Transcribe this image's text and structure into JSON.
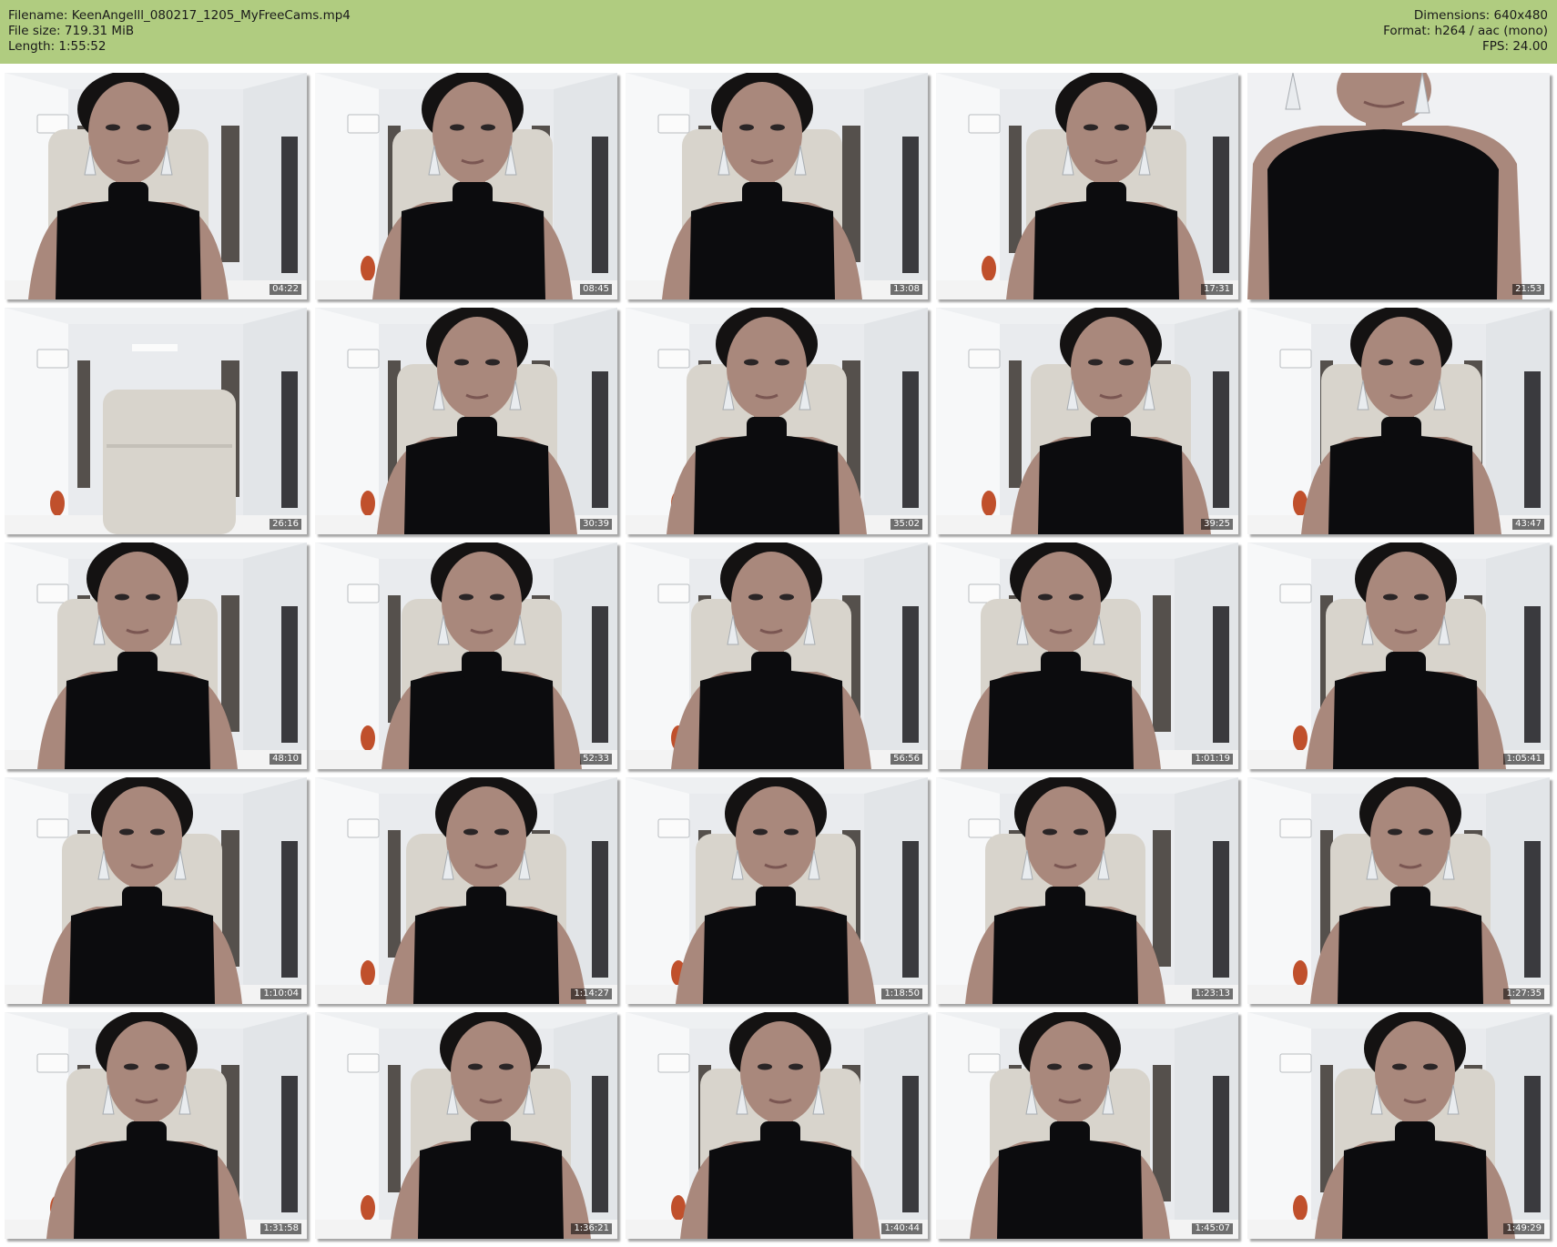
{
  "header": {
    "filename_line": "Filename: KeenAngelll_080217_1205_MyFreeCams.mp4",
    "filesize_line": "File size: 719.31 MiB",
    "length_line": "Length: 1:55:52",
    "dimensions_line": "Dimensions: 640x480",
    "format_line": "Format: h264 / aac (mono)",
    "fps_line": "FPS: 24.00"
  },
  "colors": {
    "header_bg": "#b0cc80",
    "wall": "#eef0f2",
    "outfit": "#0c0c0e",
    "hair": "#141212",
    "skin": "#a9887c",
    "chair": "#d8d4cc",
    "curtain": "#55504c"
  },
  "thumbnails": [
    {
      "timestamp": "04:22",
      "variant": "person"
    },
    {
      "timestamp": "08:45",
      "variant": "person"
    },
    {
      "timestamp": "13:08",
      "variant": "person"
    },
    {
      "timestamp": "17:31",
      "variant": "person"
    },
    {
      "timestamp": "21:53",
      "variant": "closeup"
    },
    {
      "timestamp": "26:16",
      "variant": "empty"
    },
    {
      "timestamp": "30:39",
      "variant": "person"
    },
    {
      "timestamp": "35:02",
      "variant": "person"
    },
    {
      "timestamp": "39:25",
      "variant": "person"
    },
    {
      "timestamp": "43:47",
      "variant": "person"
    },
    {
      "timestamp": "48:10",
      "variant": "person"
    },
    {
      "timestamp": "52:33",
      "variant": "person"
    },
    {
      "timestamp": "56:56",
      "variant": "person"
    },
    {
      "timestamp": "1:01:19",
      "variant": "person"
    },
    {
      "timestamp": "1:05:41",
      "variant": "person"
    },
    {
      "timestamp": "1:10:04",
      "variant": "person"
    },
    {
      "timestamp": "1:14:27",
      "variant": "person"
    },
    {
      "timestamp": "1:18:50",
      "variant": "person"
    },
    {
      "timestamp": "1:23:13",
      "variant": "person"
    },
    {
      "timestamp": "1:27:35",
      "variant": "person"
    },
    {
      "timestamp": "1:31:58",
      "variant": "person"
    },
    {
      "timestamp": "1:36:21",
      "variant": "person"
    },
    {
      "timestamp": "1:40:44",
      "variant": "person"
    },
    {
      "timestamp": "1:45:07",
      "variant": "person"
    },
    {
      "timestamp": "1:49:29",
      "variant": "person"
    }
  ]
}
